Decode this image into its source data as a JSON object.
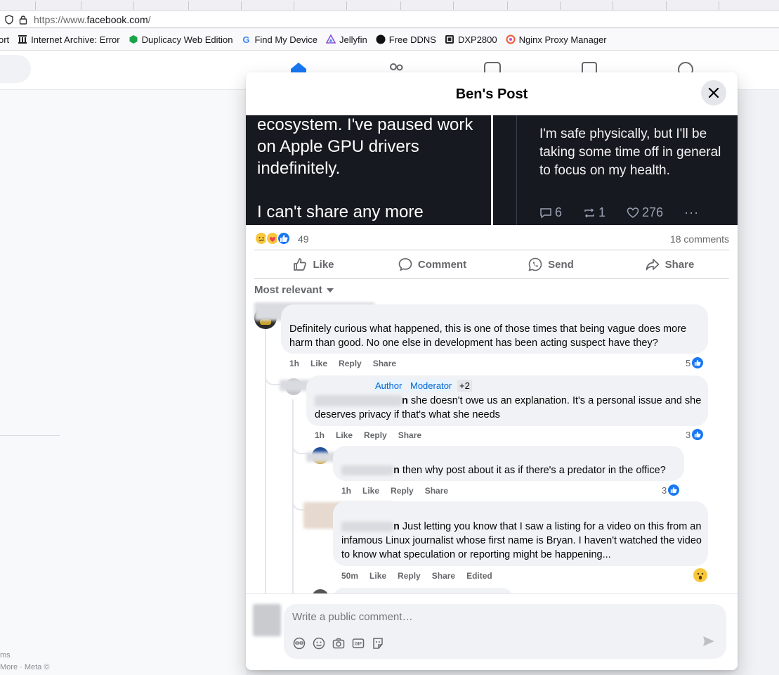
{
  "browser": {
    "url_prefix": "https://www.",
    "url_domain": "facebook.com",
    "url_suffix": "/",
    "bookmarks": [
      {
        "label": "ort"
      },
      {
        "label": "Internet Archive: Error"
      },
      {
        "label": "Duplicacy Web Edition"
      },
      {
        "label": "Find My Device"
      },
      {
        "label": "Jellyfin"
      },
      {
        "label": "Free DDNS"
      },
      {
        "label": "DXP2800"
      },
      {
        "label": "Nginx Proxy Manager"
      }
    ]
  },
  "left_footer": {
    "line1": "ms",
    "line2": "More · Meta ©"
  },
  "modal": {
    "title": "Ben's Post",
    "post_image": {
      "left_text": "ecosystem. I've paused work on Apple GPU drivers indefinitely.",
      "left_text_2": "I can't share any more",
      "right_text": "I'm safe physically, but I'll be taking some time off in general to focus on my health.",
      "replies": "6",
      "reposts": "1",
      "likes": "276"
    },
    "reactions_count": "49",
    "comments_count": "18 comments",
    "actions": {
      "like": "Like",
      "comment": "Comment",
      "send": "Send",
      "share": "Share"
    },
    "sort_label": "Most relevant",
    "comments": [
      {
        "text": "Definitely curious what happened, this is one of those times that being vague does more harm than good. No one else in development has been acting suspect have they?",
        "time": "1h",
        "like": "Like",
        "reply": "Reply",
        "share": "Share",
        "likes": "5"
      },
      {
        "badge_author": "Author",
        "badge_moderator": "Moderator",
        "badge_plus": "+2",
        "mention_tail": "n",
        "text": " she doesn't owe us an explanation. It's a personal issue and she deserves privacy if that's what she needs",
        "time": "1h",
        "like": "Like",
        "reply": "Reply",
        "share": "Share",
        "likes": "3"
      },
      {
        "mention_tail": "n",
        "text": " then why post about it as if there's a predator in the office?",
        "time": "1h",
        "like": "Like",
        "reply": "Reply",
        "share": "Share",
        "likes": "3"
      },
      {
        "mention_tail": "n",
        "text": " Just letting you know that I saw a listing for a video on this from an infamous Linux journalist whose first name is Bryan. I haven't watched the video to know what speculation or reporting might be happening...",
        "time": "50m",
        "like": "Like",
        "reply": "Reply",
        "share": "Share",
        "edited": "Edited"
      }
    ],
    "write_placeholder": "Write a public comment…"
  },
  "colors": {
    "fb_blue": "#1877f2",
    "image_bg": "#16191f",
    "muted_text": "#65676b",
    "bubble_bg": "#f0f2f5"
  }
}
